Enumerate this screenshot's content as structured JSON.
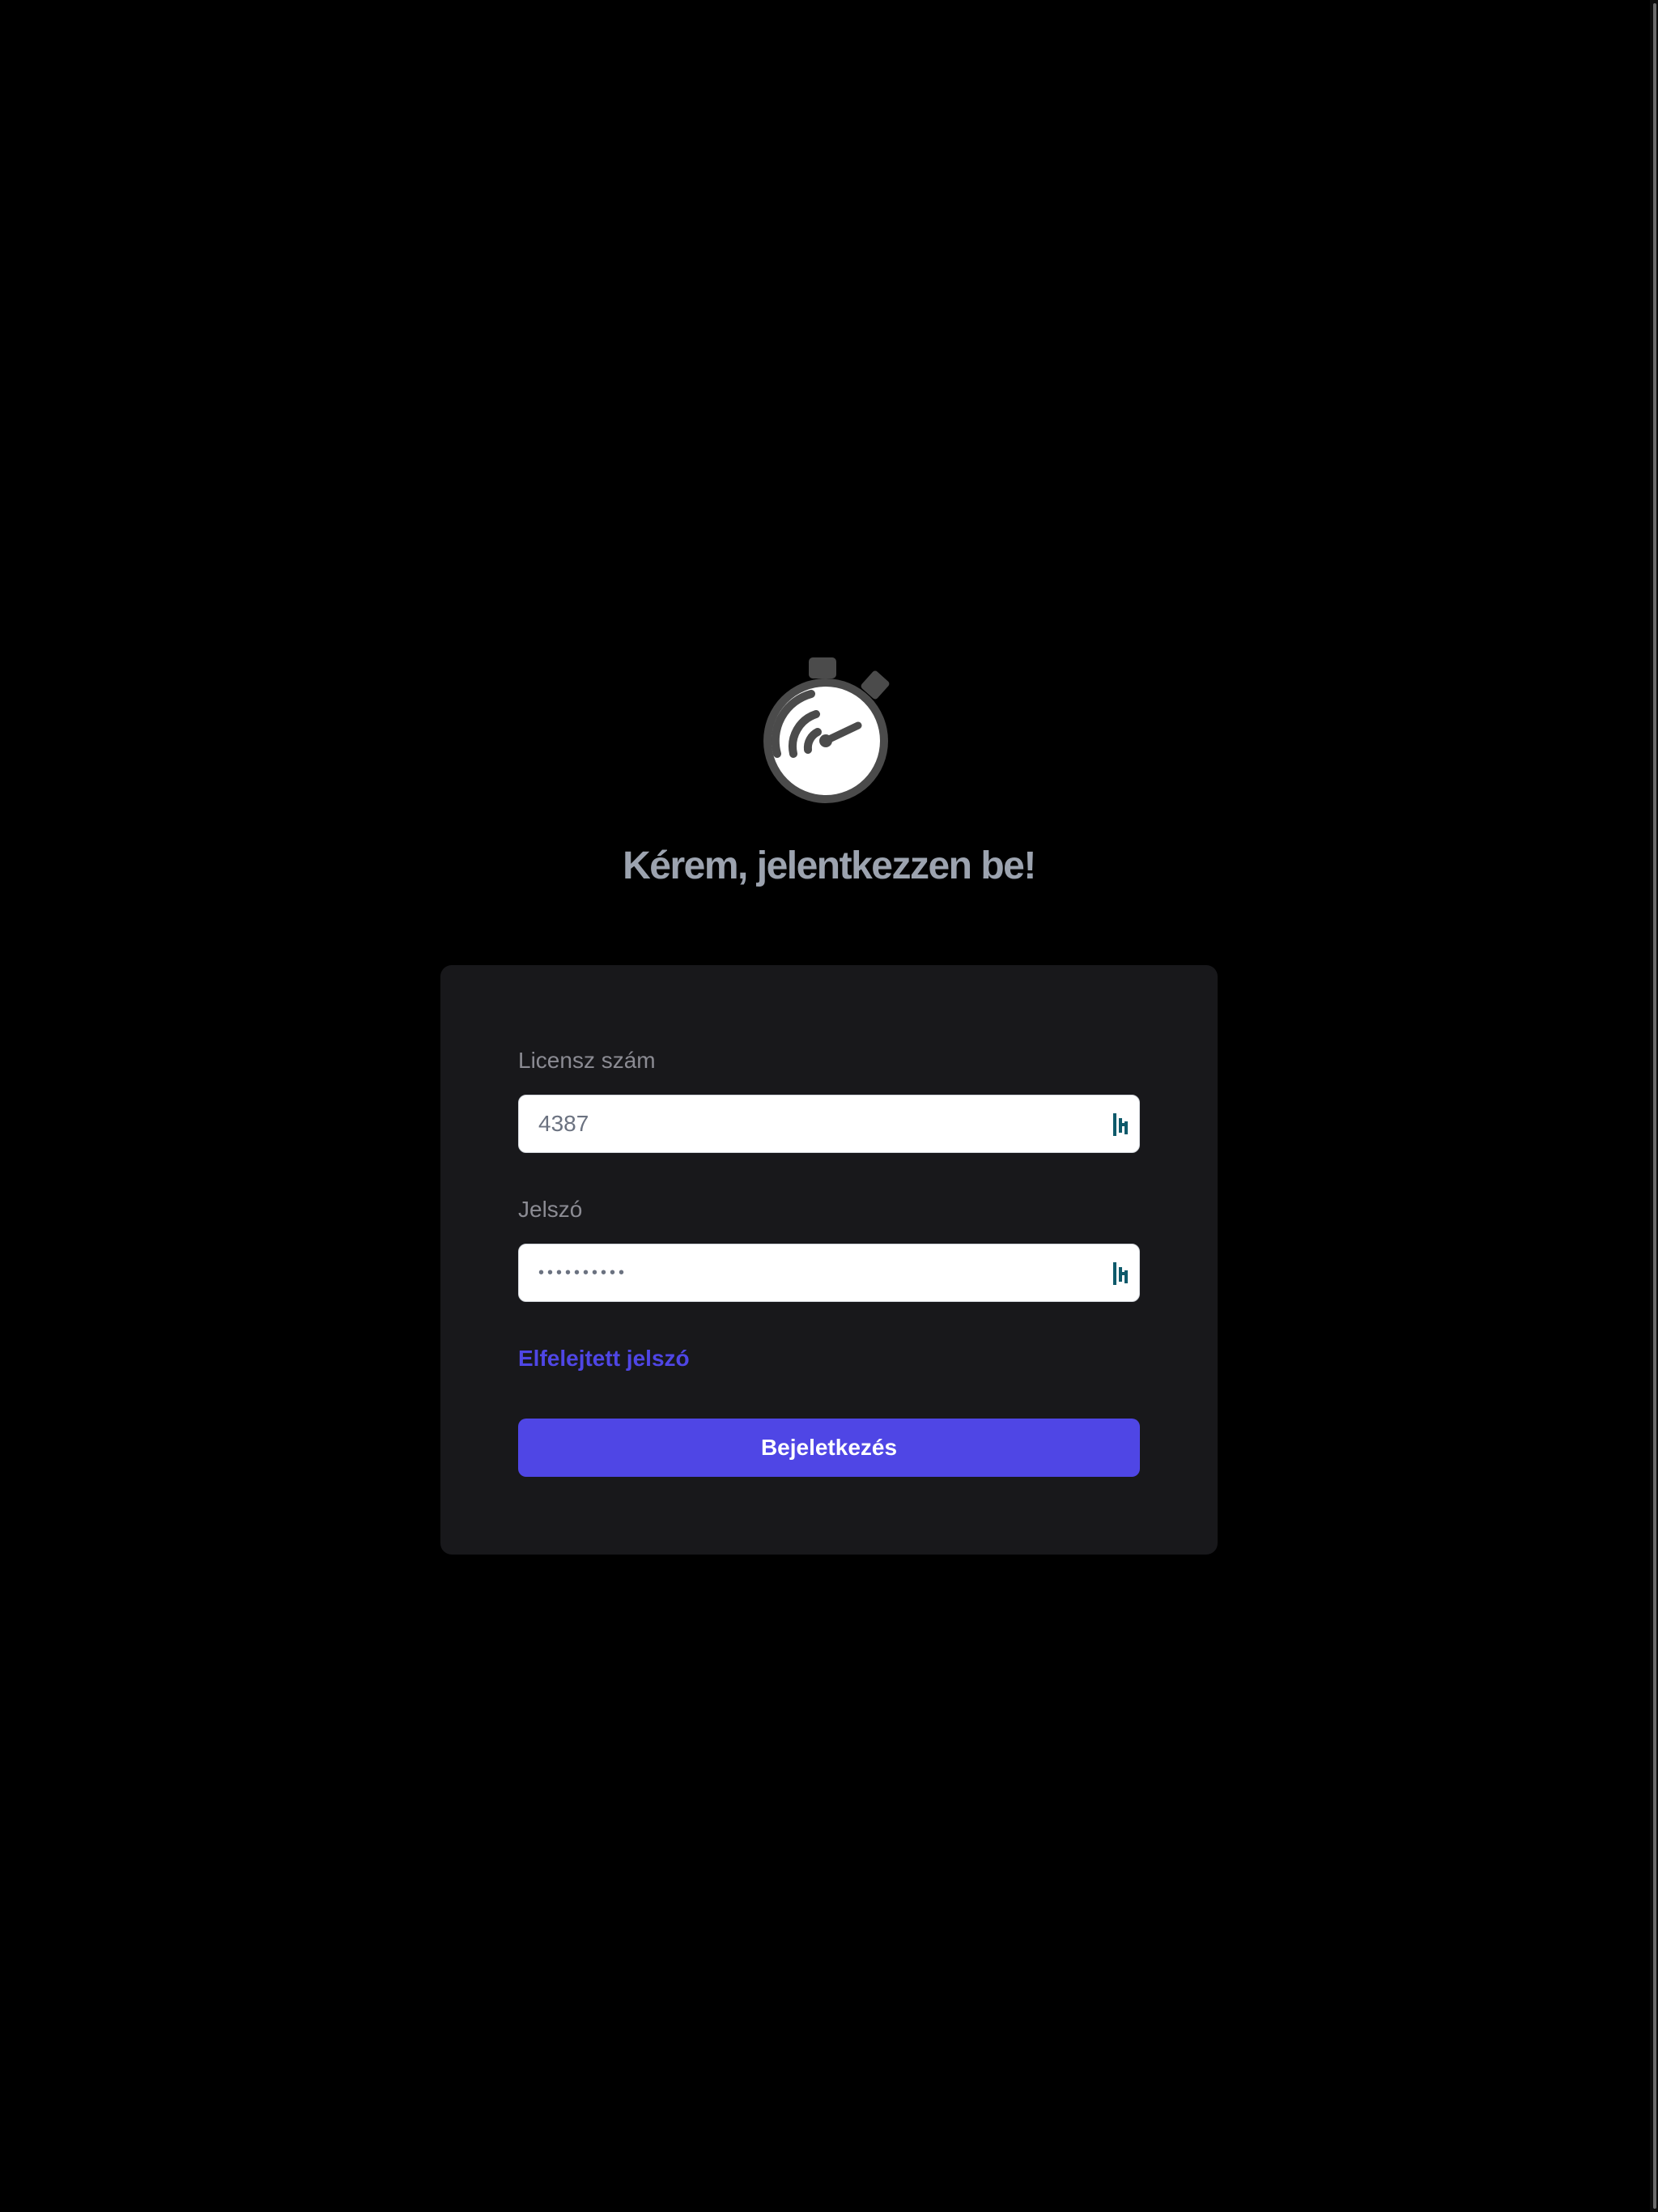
{
  "page": {
    "title": "Kérem, jelentkezzen be!"
  },
  "login_form": {
    "license_label": "Licensz szám",
    "license_value": "4387",
    "password_label": "Jelszó",
    "password_value": "••••••••••",
    "forgot_password_label": "Elfelejtett jelszó",
    "submit_label": "Bejeletkezés"
  },
  "icons": {
    "logo": "stopwatch-icon",
    "field_icon": "password-manager-icon"
  },
  "colors": {
    "accent": "#4f46e5",
    "background": "#000000",
    "card": "#18181b",
    "title": "#9ca3af"
  }
}
